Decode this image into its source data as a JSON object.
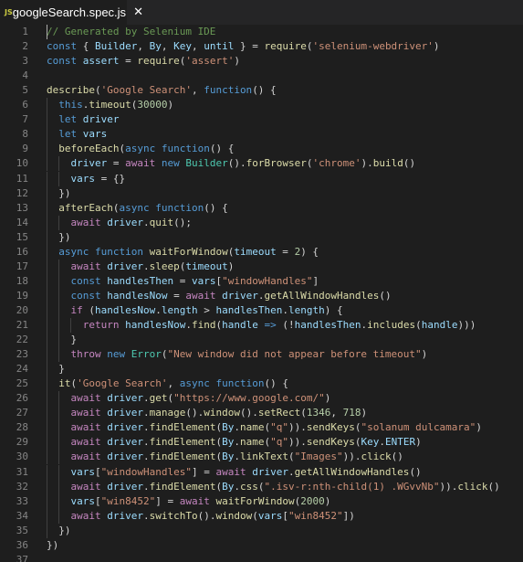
{
  "tab": {
    "icon_label": "JS",
    "title": "googleSearch.spec.js",
    "close_glyph": "✕"
  },
  "colors": {
    "background": "#1e1e1e",
    "line_number": "#858585",
    "comment": "#6a9955",
    "keyword": "#569cd6",
    "control": "#c586c0",
    "string": "#ce9178",
    "function": "#dcdcaa",
    "variable": "#9cdcfe",
    "class": "#4ec9b0",
    "number": "#b5cea8"
  },
  "code_lines": [
    [
      [
        "cmt",
        "// Generated by Selenium IDE"
      ]
    ],
    [
      [
        "kw",
        "const"
      ],
      [
        "p",
        " { "
      ],
      [
        "var",
        "Builder"
      ],
      [
        "p",
        ", "
      ],
      [
        "var",
        "By"
      ],
      [
        "p",
        ", "
      ],
      [
        "var",
        "Key"
      ],
      [
        "p",
        ", "
      ],
      [
        "var",
        "until"
      ],
      [
        "p",
        " } = "
      ],
      [
        "fn",
        "require"
      ],
      [
        "p",
        "("
      ],
      [
        "str",
        "'selenium-webdriver'"
      ],
      [
        "p",
        ")"
      ]
    ],
    [
      [
        "kw",
        "const"
      ],
      [
        "p",
        " "
      ],
      [
        "var",
        "assert"
      ],
      [
        "p",
        " = "
      ],
      [
        "fn",
        "require"
      ],
      [
        "p",
        "("
      ],
      [
        "str",
        "'assert'"
      ],
      [
        "p",
        ")"
      ]
    ],
    [],
    [
      [
        "fn",
        "describe"
      ],
      [
        "p",
        "("
      ],
      [
        "str",
        "'Google Search'"
      ],
      [
        "p",
        ", "
      ],
      [
        "kw",
        "function"
      ],
      [
        "p",
        "() {"
      ]
    ],
    [
      [
        "p",
        "  "
      ],
      [
        "kw",
        "this"
      ],
      [
        "p",
        "."
      ],
      [
        "fn",
        "timeout"
      ],
      [
        "p",
        "("
      ],
      [
        "num",
        "30000"
      ],
      [
        "p",
        ")"
      ]
    ],
    [
      [
        "p",
        "  "
      ],
      [
        "kw",
        "let"
      ],
      [
        "p",
        " "
      ],
      [
        "var",
        "driver"
      ]
    ],
    [
      [
        "p",
        "  "
      ],
      [
        "kw",
        "let"
      ],
      [
        "p",
        " "
      ],
      [
        "var",
        "vars"
      ]
    ],
    [
      [
        "p",
        "  "
      ],
      [
        "fn",
        "beforeEach"
      ],
      [
        "p",
        "("
      ],
      [
        "kw",
        "async"
      ],
      [
        "p",
        " "
      ],
      [
        "kw",
        "function"
      ],
      [
        "p",
        "() {"
      ]
    ],
    [
      [
        "p",
        "    "
      ],
      [
        "var",
        "driver"
      ],
      [
        "p",
        " = "
      ],
      [
        "ctl",
        "await"
      ],
      [
        "p",
        " "
      ],
      [
        "kw",
        "new"
      ],
      [
        "p",
        " "
      ],
      [
        "cls",
        "Builder"
      ],
      [
        "p",
        "()."
      ],
      [
        "fn",
        "forBrowser"
      ],
      [
        "p",
        "("
      ],
      [
        "str",
        "'chrome'"
      ],
      [
        "p",
        ")."
      ],
      [
        "fn",
        "build"
      ],
      [
        "p",
        "()"
      ]
    ],
    [
      [
        "p",
        "    "
      ],
      [
        "var",
        "vars"
      ],
      [
        "p",
        " = {}"
      ]
    ],
    [
      [
        "p",
        "  })"
      ]
    ],
    [
      [
        "p",
        "  "
      ],
      [
        "fn",
        "afterEach"
      ],
      [
        "p",
        "("
      ],
      [
        "kw",
        "async"
      ],
      [
        "p",
        " "
      ],
      [
        "kw",
        "function"
      ],
      [
        "p",
        "() {"
      ]
    ],
    [
      [
        "p",
        "    "
      ],
      [
        "ctl",
        "await"
      ],
      [
        "p",
        " "
      ],
      [
        "var",
        "driver"
      ],
      [
        "p",
        "."
      ],
      [
        "fn",
        "quit"
      ],
      [
        "p",
        "();"
      ]
    ],
    [
      [
        "p",
        "  })"
      ]
    ],
    [
      [
        "p",
        "  "
      ],
      [
        "kw",
        "async"
      ],
      [
        "p",
        " "
      ],
      [
        "kw",
        "function"
      ],
      [
        "p",
        " "
      ],
      [
        "fn",
        "waitForWindow"
      ],
      [
        "p",
        "("
      ],
      [
        "var",
        "timeout"
      ],
      [
        "p",
        " = "
      ],
      [
        "num",
        "2"
      ],
      [
        "p",
        ") {"
      ]
    ],
    [
      [
        "p",
        "    "
      ],
      [
        "ctl",
        "await"
      ],
      [
        "p",
        " "
      ],
      [
        "var",
        "driver"
      ],
      [
        "p",
        "."
      ],
      [
        "fn",
        "sleep"
      ],
      [
        "p",
        "("
      ],
      [
        "var",
        "timeout"
      ],
      [
        "p",
        ")"
      ]
    ],
    [
      [
        "p",
        "    "
      ],
      [
        "kw",
        "const"
      ],
      [
        "p",
        " "
      ],
      [
        "var",
        "handlesThen"
      ],
      [
        "p",
        " = "
      ],
      [
        "var",
        "vars"
      ],
      [
        "p",
        "["
      ],
      [
        "str",
        "\"windowHandles\""
      ],
      [
        "p",
        "]"
      ]
    ],
    [
      [
        "p",
        "    "
      ],
      [
        "kw",
        "const"
      ],
      [
        "p",
        " "
      ],
      [
        "var",
        "handlesNow"
      ],
      [
        "p",
        " = "
      ],
      [
        "ctl",
        "await"
      ],
      [
        "p",
        " "
      ],
      [
        "var",
        "driver"
      ],
      [
        "p",
        "."
      ],
      [
        "fn",
        "getAllWindowHandles"
      ],
      [
        "p",
        "()"
      ]
    ],
    [
      [
        "p",
        "    "
      ],
      [
        "ctl",
        "if"
      ],
      [
        "p",
        " ("
      ],
      [
        "var",
        "handlesNow"
      ],
      [
        "p",
        "."
      ],
      [
        "var",
        "length"
      ],
      [
        "p",
        " > "
      ],
      [
        "var",
        "handlesThen"
      ],
      [
        "p",
        "."
      ],
      [
        "var",
        "length"
      ],
      [
        "p",
        ") {"
      ]
    ],
    [
      [
        "p",
        "      "
      ],
      [
        "ctl",
        "return"
      ],
      [
        "p",
        " "
      ],
      [
        "var",
        "handlesNow"
      ],
      [
        "p",
        "."
      ],
      [
        "fn",
        "find"
      ],
      [
        "p",
        "("
      ],
      [
        "var",
        "handle"
      ],
      [
        "p",
        " "
      ],
      [
        "kw",
        "=>"
      ],
      [
        "p",
        " (!"
      ],
      [
        "var",
        "handlesThen"
      ],
      [
        "p",
        "."
      ],
      [
        "fn",
        "includes"
      ],
      [
        "p",
        "("
      ],
      [
        "var",
        "handle"
      ],
      [
        "p",
        ")))"
      ]
    ],
    [
      [
        "p",
        "    }"
      ]
    ],
    [
      [
        "p",
        "    "
      ],
      [
        "ctl",
        "throw"
      ],
      [
        "p",
        " "
      ],
      [
        "kw",
        "new"
      ],
      [
        "p",
        " "
      ],
      [
        "cls",
        "Error"
      ],
      [
        "p",
        "("
      ],
      [
        "str",
        "\"New window did not appear before timeout\""
      ],
      [
        "p",
        ")"
      ]
    ],
    [
      [
        "p",
        "  }"
      ]
    ],
    [
      [
        "p",
        "  "
      ],
      [
        "fn",
        "it"
      ],
      [
        "p",
        "("
      ],
      [
        "str",
        "'Google Search'"
      ],
      [
        "p",
        ", "
      ],
      [
        "kw",
        "async"
      ],
      [
        "p",
        " "
      ],
      [
        "kw",
        "function"
      ],
      [
        "p",
        "() {"
      ]
    ],
    [
      [
        "p",
        "    "
      ],
      [
        "ctl",
        "await"
      ],
      [
        "p",
        " "
      ],
      [
        "var",
        "driver"
      ],
      [
        "p",
        "."
      ],
      [
        "fn",
        "get"
      ],
      [
        "p",
        "("
      ],
      [
        "str",
        "\"https://www.google.com/\""
      ],
      [
        "p",
        ")"
      ]
    ],
    [
      [
        "p",
        "    "
      ],
      [
        "ctl",
        "await"
      ],
      [
        "p",
        " "
      ],
      [
        "var",
        "driver"
      ],
      [
        "p",
        "."
      ],
      [
        "fn",
        "manage"
      ],
      [
        "p",
        "()."
      ],
      [
        "fn",
        "window"
      ],
      [
        "p",
        "()."
      ],
      [
        "fn",
        "setRect"
      ],
      [
        "p",
        "("
      ],
      [
        "num",
        "1346"
      ],
      [
        "p",
        ", "
      ],
      [
        "num",
        "718"
      ],
      [
        "p",
        ")"
      ]
    ],
    [
      [
        "p",
        "    "
      ],
      [
        "ctl",
        "await"
      ],
      [
        "p",
        " "
      ],
      [
        "var",
        "driver"
      ],
      [
        "p",
        "."
      ],
      [
        "fn",
        "findElement"
      ],
      [
        "p",
        "("
      ],
      [
        "var",
        "By"
      ],
      [
        "p",
        "."
      ],
      [
        "fn",
        "name"
      ],
      [
        "p",
        "("
      ],
      [
        "str",
        "\"q\""
      ],
      [
        "p",
        "))."
      ],
      [
        "fn",
        "sendKeys"
      ],
      [
        "p",
        "("
      ],
      [
        "str",
        "\"solanum dulcamara\""
      ],
      [
        "p",
        ")"
      ]
    ],
    [
      [
        "p",
        "    "
      ],
      [
        "ctl",
        "await"
      ],
      [
        "p",
        " "
      ],
      [
        "var",
        "driver"
      ],
      [
        "p",
        "."
      ],
      [
        "fn",
        "findElement"
      ],
      [
        "p",
        "("
      ],
      [
        "var",
        "By"
      ],
      [
        "p",
        "."
      ],
      [
        "fn",
        "name"
      ],
      [
        "p",
        "("
      ],
      [
        "str",
        "\"q\""
      ],
      [
        "p",
        "))."
      ],
      [
        "fn",
        "sendKeys"
      ],
      [
        "p",
        "("
      ],
      [
        "var",
        "Key"
      ],
      [
        "p",
        "."
      ],
      [
        "var",
        "ENTER"
      ],
      [
        "p",
        ")"
      ]
    ],
    [
      [
        "p",
        "    "
      ],
      [
        "ctl",
        "await"
      ],
      [
        "p",
        " "
      ],
      [
        "var",
        "driver"
      ],
      [
        "p",
        "."
      ],
      [
        "fn",
        "findElement"
      ],
      [
        "p",
        "("
      ],
      [
        "var",
        "By"
      ],
      [
        "p",
        "."
      ],
      [
        "fn",
        "linkText"
      ],
      [
        "p",
        "("
      ],
      [
        "str",
        "\"Images\""
      ],
      [
        "p",
        "))."
      ],
      [
        "fn",
        "click"
      ],
      [
        "p",
        "()"
      ]
    ],
    [
      [
        "p",
        "    "
      ],
      [
        "var",
        "vars"
      ],
      [
        "p",
        "["
      ],
      [
        "str",
        "\"windowHandles\""
      ],
      [
        "p",
        "] = "
      ],
      [
        "ctl",
        "await"
      ],
      [
        "p",
        " "
      ],
      [
        "var",
        "driver"
      ],
      [
        "p",
        "."
      ],
      [
        "fn",
        "getAllWindowHandles"
      ],
      [
        "p",
        "()"
      ]
    ],
    [
      [
        "p",
        "    "
      ],
      [
        "ctl",
        "await"
      ],
      [
        "p",
        " "
      ],
      [
        "var",
        "driver"
      ],
      [
        "p",
        "."
      ],
      [
        "fn",
        "findElement"
      ],
      [
        "p",
        "("
      ],
      [
        "var",
        "By"
      ],
      [
        "p",
        "."
      ],
      [
        "fn",
        "css"
      ],
      [
        "p",
        "("
      ],
      [
        "str",
        "\".isv-r:nth-child(1) .WGvvNb\""
      ],
      [
        "p",
        "))."
      ],
      [
        "fn",
        "click"
      ],
      [
        "p",
        "()"
      ]
    ],
    [
      [
        "p",
        "    "
      ],
      [
        "var",
        "vars"
      ],
      [
        "p",
        "["
      ],
      [
        "str",
        "\"win8452\""
      ],
      [
        "p",
        "] = "
      ],
      [
        "ctl",
        "await"
      ],
      [
        "p",
        " "
      ],
      [
        "fn",
        "waitForWindow"
      ],
      [
        "p",
        "("
      ],
      [
        "num",
        "2000"
      ],
      [
        "p",
        ")"
      ]
    ],
    [
      [
        "p",
        "    "
      ],
      [
        "ctl",
        "await"
      ],
      [
        "p",
        " "
      ],
      [
        "var",
        "driver"
      ],
      [
        "p",
        "."
      ],
      [
        "fn",
        "switchTo"
      ],
      [
        "p",
        "()."
      ],
      [
        "fn",
        "window"
      ],
      [
        "p",
        "("
      ],
      [
        "var",
        "vars"
      ],
      [
        "p",
        "["
      ],
      [
        "str",
        "\"win8452\""
      ],
      [
        "p",
        "])"
      ]
    ],
    [
      [
        "p",
        "  })"
      ]
    ],
    [
      [
        "p",
        "})"
      ]
    ],
    []
  ]
}
